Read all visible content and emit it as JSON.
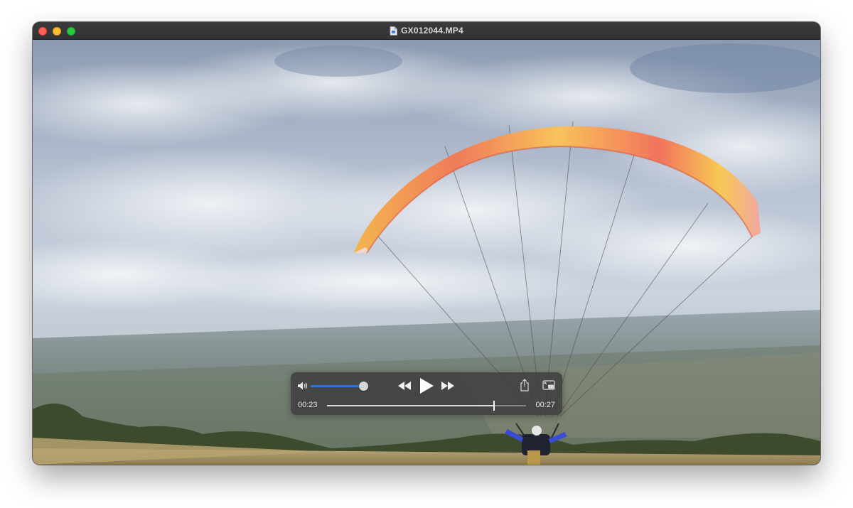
{
  "window": {
    "title": "GX012044.MP4",
    "file_icon": "document-icon"
  },
  "player": {
    "volume_fraction": 0.95,
    "current_time": "00:23",
    "total_time": "00:27",
    "progress_fraction": 0.84,
    "accent_color": "#2f6fe4",
    "icons": {
      "volume": "speaker-icon",
      "rewind": "rewind-icon",
      "play": "play-icon",
      "fast_forward": "fast-forward-icon",
      "share": "share-icon",
      "picture_in_picture": "picture-in-picture-icon"
    }
  }
}
